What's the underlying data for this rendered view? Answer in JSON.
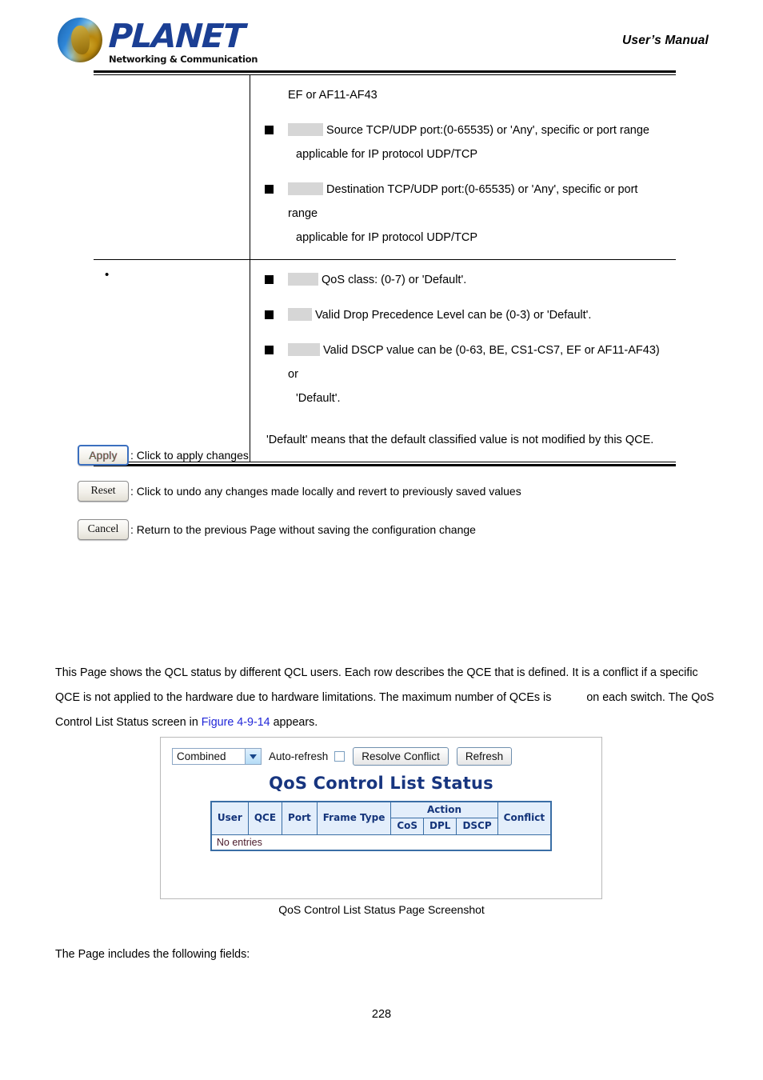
{
  "header": {
    "brand_word": "PLANET",
    "brand_tagline": "Networking & Communication",
    "manual_label": "User’s Manual"
  },
  "spec_table": {
    "rows": [
      {
        "left_marker": "",
        "lead_line": "EF or AF11-AF43",
        "bullets": [
          {
            "redacted_width": 44,
            "text": "Source TCP/UDP port:(0-65535) or 'Any', specific or port range",
            "continuation": "applicable for IP protocol UDP/TCP"
          },
          {
            "redacted_width": 44,
            "text": "Destination TCP/UDP port:(0-65535) or 'Any', specific or port range",
            "continuation": "applicable for IP protocol UDP/TCP"
          }
        ],
        "note": ""
      },
      {
        "left_marker": "•",
        "lead_line": "",
        "bullets": [
          {
            "redacted_width": 38,
            "text": "QoS class: (0-7) or 'Default'.",
            "continuation": ""
          },
          {
            "redacted_width": 30,
            "text": "Valid Drop Precedence Level can be (0-3) or 'Default'.",
            "continuation": ""
          },
          {
            "redacted_width": 40,
            "text": "Valid DSCP value can be (0-63, BE, CS1-CS7, EF or AF11-AF43) or",
            "continuation": "'Default'."
          }
        ],
        "note": "'Default' means that the default classified value is not modified by this QCE."
      }
    ]
  },
  "legend": {
    "items": [
      {
        "button": "Apply",
        "description": ": Click to apply changes"
      },
      {
        "button": "Reset",
        "description": ": Click to undo any changes made locally and revert to previously saved values"
      },
      {
        "button": "Cancel",
        "description": ": Return to the previous Page without saving the configuration change"
      }
    ]
  },
  "paragraph": {
    "part1": "This Page shows the QCL status by different QCL users. Each row describes the QCE that is defined. It is a conflict if a specific QCE is not applied to the hardware due to hardware limitations. The maximum number of QCEs is",
    "part2": "on each switch. The QoS Control List Status screen in",
    "figure_link": "Figure 4-9-14",
    "part3": "appears."
  },
  "screenshot": {
    "toolbar": {
      "select_value": "Combined",
      "select_options": [
        "Combined"
      ],
      "autorefresh_label": "Auto-refresh",
      "autorefresh_checked": false,
      "resolve_button": "Resolve Conflict",
      "refresh_button": "Refresh"
    },
    "title": "QoS Control List Status",
    "table": {
      "group_header": "Action",
      "headers_left": [
        "User",
        "QCE",
        "Port",
        "Frame Type"
      ],
      "headers_action": [
        "CoS",
        "DPL",
        "DSCP"
      ],
      "header_right": "Conflict",
      "empty_text": "No entries"
    },
    "colors": {
      "title": "#17357f",
      "table_header_bg": "#e3eefb",
      "table_border": "#3a6ea5"
    }
  },
  "caption": "QoS Control List Status Page Screenshot",
  "tail_paragraph": "The Page includes the following fields:",
  "page_number": "228"
}
